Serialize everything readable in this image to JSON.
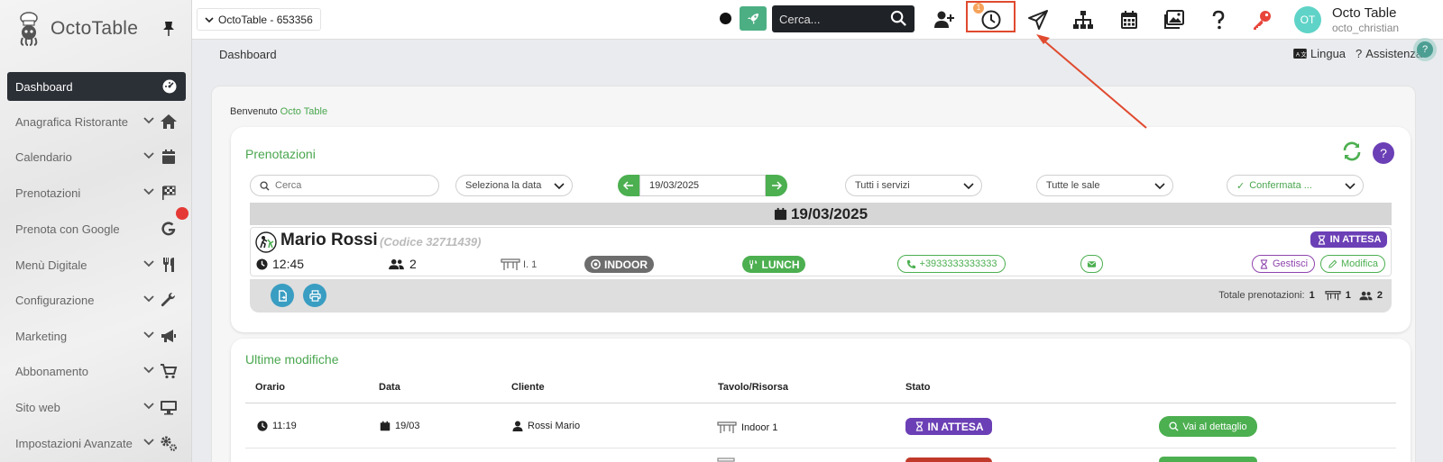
{
  "sidebar": {
    "brand": "OctoTable",
    "active_item": "Dashboard",
    "items": [
      {
        "label": "Anagrafica Ristorante"
      },
      {
        "label": "Calendario"
      },
      {
        "label": "Prenotazioni"
      },
      {
        "label": "Prenota con Google"
      },
      {
        "label": "Menù Digitale"
      },
      {
        "label": "Configurazione"
      },
      {
        "label": "Marketing"
      },
      {
        "label": "Abbonamento"
      },
      {
        "label": "Sito web"
      },
      {
        "label": "Impostazioni Avanzate"
      }
    ]
  },
  "topbar": {
    "venue": "OctoTable - 653356",
    "search_placeholder": "Cerca...",
    "notification_count": "1",
    "avatar_initials": "OT",
    "user_name": "Octo Table",
    "user_handle": "octo_christian"
  },
  "subbar": {
    "breadcrumb": "Dashboard",
    "language": "Lingua",
    "help": "Assistenza",
    "help_bubble": "?"
  },
  "welcome": {
    "prefix": "Benvenuto",
    "name": "Octo Table"
  },
  "reservations": {
    "title": "Prenotazioni",
    "help": "?",
    "search_placeholder": "Cerca",
    "date_select": "Seleziona la data",
    "date_value": "19/03/2025",
    "services": "Tutti i servizi",
    "rooms": "Tutte le sale",
    "status_filter": "Confermata ...",
    "date_header": "19/03/2025",
    "entry": {
      "name": "Mario Rossi",
      "code": "(Codice 32711439)",
      "time": "12:45",
      "guests": "2",
      "table": "I. 1",
      "room": "INDOOR",
      "service": "LUNCH",
      "phone": "+3933333333333",
      "status": "IN ATTESA",
      "manage": "Gestisci",
      "edit": "Modifica"
    },
    "totals_label": "Totale prenotazioni:",
    "totals_count": "1",
    "totals_tables": "1",
    "totals_guests": "2"
  },
  "changes": {
    "title": "Ultime modifiche",
    "columns": [
      "Orario",
      "Data",
      "Cliente",
      "Tavolo/Risorsa",
      "Stato"
    ],
    "rows": [
      {
        "time": "11:19",
        "date": "19/03",
        "client": "Rossi Mario",
        "table": "Indoor 1",
        "status": "IN ATTESA",
        "action": "Vai al dettaglio"
      }
    ]
  },
  "colors": {
    "accent_green": "#4aa64f",
    "status_purple": "#6b3fb5",
    "highlight_red": "#e04a2f"
  }
}
